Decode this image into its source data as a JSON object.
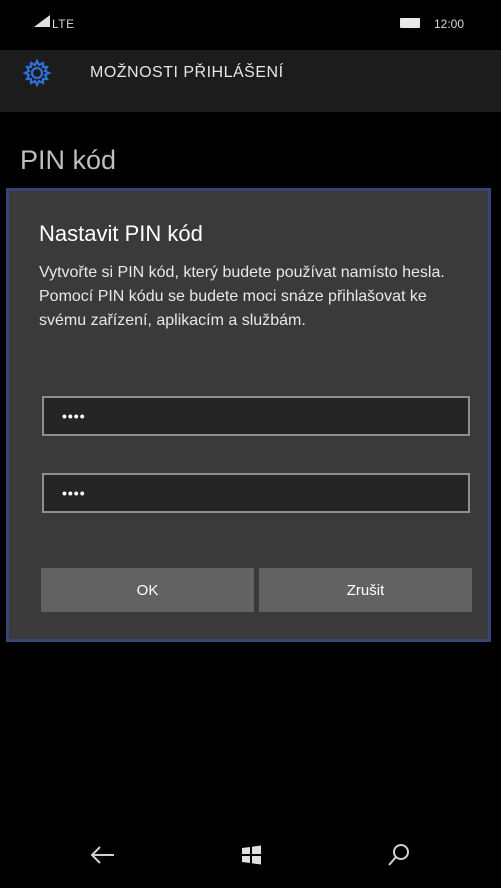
{
  "status_bar": {
    "network": "LTE",
    "time": "12:00",
    "signal_icon": "signal-bars-icon",
    "battery_icon": "battery-icon"
  },
  "header": {
    "icon": "gear-icon",
    "title": "MOŽNOSTI PŘIHLÁŠENÍ"
  },
  "section_title": "PIN kód",
  "dialog": {
    "title": "Nastavit PIN kód",
    "description": "Vytvořte si PIN kód, který budete používat namísto hesla. Pomocí PIN kódu se budete moci snáze přihlašovat ke svému zařízení, aplikacím a službám.",
    "fields": [
      {
        "value": "••••"
      },
      {
        "value": "••••"
      }
    ],
    "ok_label": "OK",
    "cancel_label": "Zrušit"
  },
  "nav_bar": {
    "back_icon": "back-arrow-icon",
    "start_icon": "windows-start-icon",
    "search_icon": "search-icon"
  },
  "colors": {
    "background": "#000000",
    "header_bg": "#1c1c1c",
    "dialog_bg": "#3a3a3a",
    "dialog_border": "#35457a",
    "button_bg": "#626262",
    "field_bg": "#242424"
  }
}
